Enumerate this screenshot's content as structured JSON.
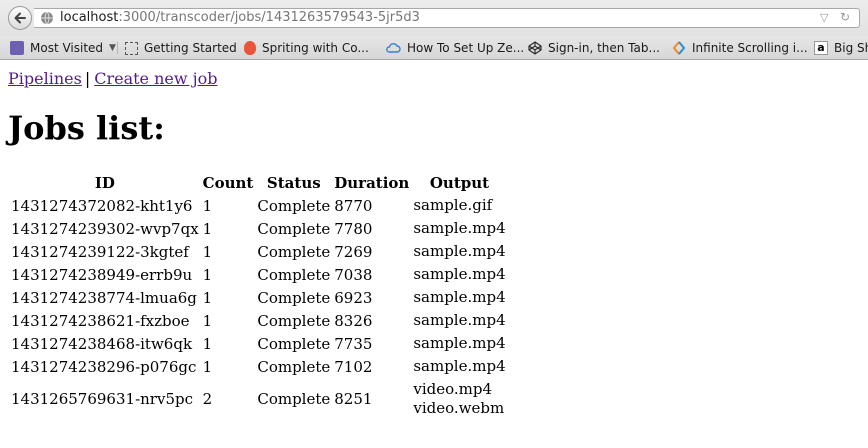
{
  "browser": {
    "url_host": "localhost",
    "url_path": ":3000/transcoder/jobs/1431263579543-5jr5d3",
    "bookmarks": [
      {
        "label": "Most Visited",
        "icon": "most-visited-icon"
      },
      {
        "label": "Getting Started",
        "icon": "page-icon"
      },
      {
        "label": "Spriting with Co...",
        "icon": "flame-icon"
      },
      {
        "label": "How To Set Up Ze...",
        "icon": "cloud-icon"
      },
      {
        "label": "Sign-in, then Tab...",
        "icon": "codepen-icon"
      },
      {
        "label": "Infinite Scrolling i...",
        "icon": "arrows-icon"
      },
      {
        "label": "Big Sh",
        "icon": "amazon-icon"
      }
    ]
  },
  "nav": {
    "pipelines": "Pipelines",
    "separator": "|",
    "create_job": "Create new job"
  },
  "page": {
    "title": "Jobs list:"
  },
  "table": {
    "headers": [
      "ID",
      "Count",
      "Status",
      "Duration",
      "Output"
    ],
    "rows": [
      {
        "id": "1431274372082-kht1y6",
        "count": "1",
        "status": "Complete",
        "duration": "8770",
        "output": [
          "sample.gif"
        ]
      },
      {
        "id": "1431274239302-wvp7qx",
        "count": "1",
        "status": "Complete",
        "duration": "7780",
        "output": [
          "sample.mp4"
        ]
      },
      {
        "id": "1431274239122-3kgtef",
        "count": "1",
        "status": "Complete",
        "duration": "7269",
        "output": [
          "sample.mp4"
        ]
      },
      {
        "id": "1431274238949-errb9u",
        "count": "1",
        "status": "Complete",
        "duration": "7038",
        "output": [
          "sample.mp4"
        ]
      },
      {
        "id": "1431274238774-lmua6g",
        "count": "1",
        "status": "Complete",
        "duration": "6923",
        "output": [
          "sample.mp4"
        ]
      },
      {
        "id": "1431274238621-fxzboe",
        "count": "1",
        "status": "Complete",
        "duration": "8326",
        "output": [
          "sample.mp4"
        ]
      },
      {
        "id": "1431274238468-itw6qk",
        "count": "1",
        "status": "Complete",
        "duration": "7735",
        "output": [
          "sample.mp4"
        ]
      },
      {
        "id": "1431274238296-p076gc",
        "count": "1",
        "status": "Complete",
        "duration": "7102",
        "output": [
          "sample.mp4"
        ]
      },
      {
        "id": "1431265769631-nrv5pc",
        "count": "2",
        "status": "Complete",
        "duration": "8251",
        "output": [
          "video.mp4",
          "video.webm"
        ]
      }
    ]
  },
  "colors": {
    "link_visited": "#551a8b",
    "text": "#000000"
  }
}
